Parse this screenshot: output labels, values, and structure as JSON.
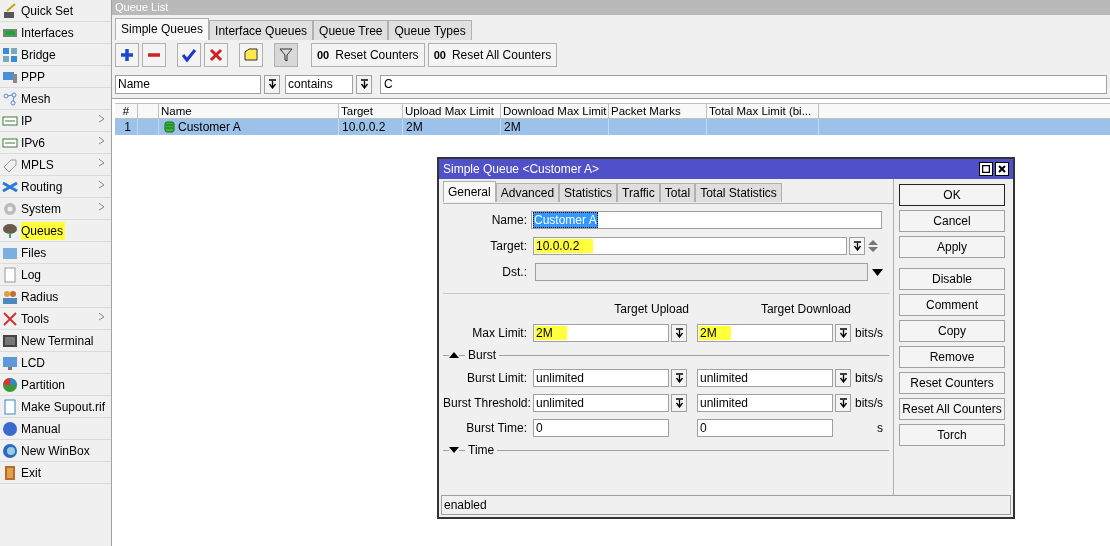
{
  "sidebar": {
    "items": [
      {
        "label": "Quick Set",
        "highlighted": false,
        "has_submenu": false
      },
      {
        "label": "Interfaces",
        "highlighted": false,
        "has_submenu": false
      },
      {
        "label": "Bridge",
        "highlighted": false,
        "has_submenu": false
      },
      {
        "label": "PPP",
        "highlighted": false,
        "has_submenu": false
      },
      {
        "label": "Mesh",
        "highlighted": false,
        "has_submenu": false
      },
      {
        "label": "IP",
        "highlighted": false,
        "has_submenu": true
      },
      {
        "label": "IPv6",
        "highlighted": false,
        "has_submenu": true
      },
      {
        "label": "MPLS",
        "highlighted": false,
        "has_submenu": true
      },
      {
        "label": "Routing",
        "highlighted": false,
        "has_submenu": true
      },
      {
        "label": "System",
        "highlighted": false,
        "has_submenu": true
      },
      {
        "label": "Queues",
        "highlighted": true,
        "has_submenu": false
      },
      {
        "label": "Files",
        "highlighted": false,
        "has_submenu": false
      },
      {
        "label": "Log",
        "highlighted": false,
        "has_submenu": false
      },
      {
        "label": "Radius",
        "highlighted": false,
        "has_submenu": false
      },
      {
        "label": "Tools",
        "highlighted": false,
        "has_submenu": true
      },
      {
        "label": "New Terminal",
        "highlighted": false,
        "has_submenu": false
      },
      {
        "label": "LCD",
        "highlighted": false,
        "has_submenu": false
      },
      {
        "label": "Partition",
        "highlighted": false,
        "has_submenu": false
      },
      {
        "label": "Make Supout.rif",
        "highlighted": false,
        "has_submenu": false
      },
      {
        "label": "Manual",
        "highlighted": false,
        "has_submenu": false
      },
      {
        "label": "New WinBox",
        "highlighted": false,
        "has_submenu": false
      },
      {
        "label": "Exit",
        "highlighted": false,
        "has_submenu": false
      }
    ]
  },
  "queue_list": {
    "title": "Queue List",
    "tabs": [
      {
        "label": "Simple Queues",
        "selected": true
      },
      {
        "label": "Interface Queues",
        "selected": false
      },
      {
        "label": "Queue Tree",
        "selected": false
      },
      {
        "label": "Queue Types",
        "selected": false
      }
    ],
    "counter_buttons": [
      {
        "icon_text": "00",
        "label": "Reset Counters"
      },
      {
        "icon_text": "00",
        "label": "Reset All Counters"
      }
    ],
    "filter": {
      "field": "Name",
      "operator": "contains",
      "value": "C"
    },
    "table": {
      "columns": [
        "#",
        "Name",
        "Target",
        "Upload Max Limit",
        "Download Max Limit",
        "Packet Marks",
        "Total Max Limit (bi..."
      ],
      "rows": [
        {
          "number": "1",
          "name": "Customer A",
          "target": "10.0.0.2",
          "upload": "2M",
          "download": "2M",
          "selected": true
        }
      ]
    }
  },
  "dialog": {
    "title": "Simple Queue <Customer A>",
    "tabs": [
      {
        "label": "General",
        "selected": true
      },
      {
        "label": "Advanced",
        "selected": false
      },
      {
        "label": "Statistics",
        "selected": false
      },
      {
        "label": "Traffic",
        "selected": false
      },
      {
        "label": "Total",
        "selected": false
      },
      {
        "label": "Total Statistics",
        "selected": false
      }
    ],
    "name": {
      "label": "Name:",
      "value": "Customer A",
      "text_selected": true
    },
    "target": {
      "label": "Target:",
      "value": "10.0.0.2",
      "highlighted": true
    },
    "dst": {
      "label": "Dst.:",
      "disabled": true
    },
    "column_headers": [
      "Target Upload",
      "Target Download"
    ],
    "max_limit": {
      "label": "Max Limit:",
      "upload": "2M",
      "download": "2M",
      "unit": "bits/s",
      "highlighted": true
    },
    "burst": {
      "label": "Burst",
      "expanded": true,
      "rows": [
        {
          "kind": "dropdown",
          "label": "Burst Limit:",
          "upload": "unlimited",
          "download": "unlimited",
          "unit": "bits/s"
        },
        {
          "kind": "dropdown",
          "label": "Burst Threshold:",
          "upload": "unlimited",
          "download": "unlimited",
          "unit": "bits/s"
        },
        {
          "kind": "plain",
          "label": "Burst Time:",
          "upload": "0",
          "download": "0",
          "unit": "s"
        }
      ]
    },
    "time": {
      "label": "Time",
      "expanded": false
    },
    "buttons": [
      "OK",
      "Cancel",
      "Apply",
      "Disable",
      "Comment",
      "Copy",
      "Remove",
      "Reset Counters",
      "Reset All Counters",
      "Torch"
    ],
    "status": "enabled"
  }
}
